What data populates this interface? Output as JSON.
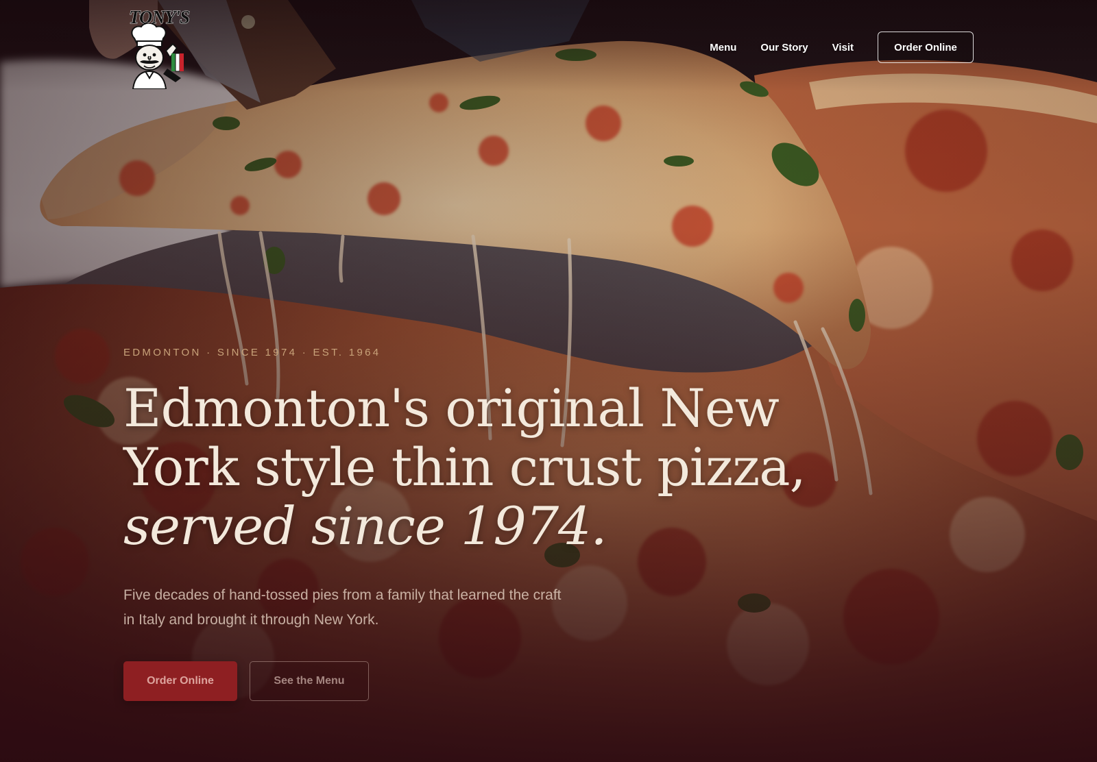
{
  "brand": {
    "logo_text": "TONY'S"
  },
  "nav": {
    "links": [
      "Menu",
      "Our Story",
      "Visit"
    ],
    "cta_label": "Order Online"
  },
  "hero": {
    "eyebrow": "EDMONTON · SINCE 1974 · EST. 1964",
    "headline_line1": "Edmonton's original New",
    "headline_line2": "York style thin crust pizza,",
    "headline_italic": "served since 1974.",
    "subtext": "Five decades of hand-tossed pies from a family that learned the craft in Italy and brought it through New York.",
    "primary_button": "Order Online",
    "secondary_button": "See the Menu"
  },
  "icons": {
    "logo_mascot": "chef-mascot-icon"
  },
  "colors": {
    "accent": "#8e1f22",
    "eyebrow": "#c9a37a",
    "headline": "#f3e9dc",
    "background_bottom": "#2a0d12"
  }
}
